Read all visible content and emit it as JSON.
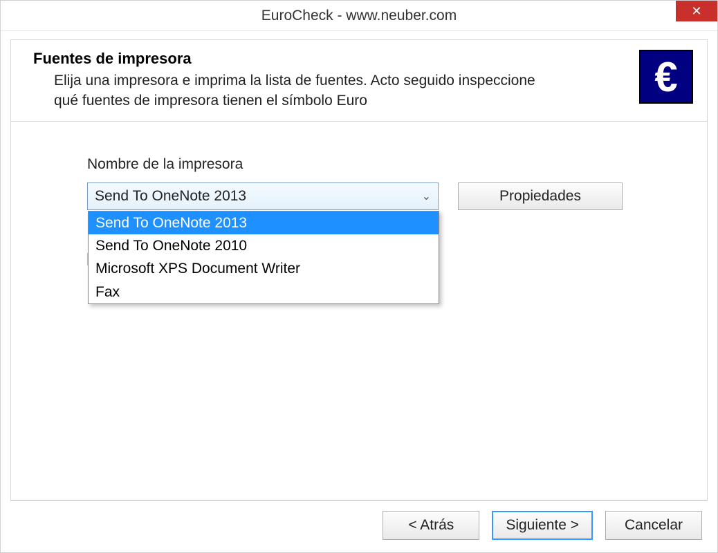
{
  "window": {
    "title": "EuroCheck - www.neuber.com",
    "close_glyph": "✕"
  },
  "header": {
    "title": "Fuentes de impresora",
    "description": "Elija una impresora e imprima la lista de fuentes. Acto seguido inspeccione qué fuentes de impresora tienen el símbolo Euro",
    "euro_glyph": "€"
  },
  "form": {
    "printer_label": "Nombre de la impresora",
    "selected_printer": "Send To OneNote 2013",
    "dropdown_items": [
      "Send To OneNote 2013",
      "Send To OneNote 2010",
      "Microsoft XPS Document Writer",
      "Fax"
    ],
    "properties_btn": "Propiedades"
  },
  "footer": {
    "back": "< Atrás",
    "next": "Siguiente >",
    "cancel": "Cancelar"
  }
}
